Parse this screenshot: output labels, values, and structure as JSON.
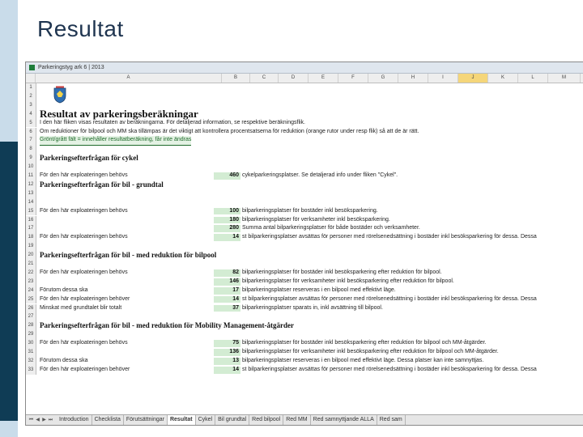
{
  "slide": {
    "title": "Resultat"
  },
  "window": {
    "title": "Parkeringstyg ark 6 | 2013"
  },
  "columns": [
    "A",
    "B",
    "C",
    "D",
    "E",
    "F",
    "G",
    "H",
    "I",
    "J",
    "K",
    "L",
    "M"
  ],
  "selected_column": "J",
  "rows": [
    {
      "n": "1"
    },
    {
      "n": "2"
    },
    {
      "n": "3"
    },
    {
      "n": "4",
      "a": "Resultat av parkeringsberäkningar"
    },
    {
      "n": "5",
      "a": "I den här fliken visas resultaten av beräkningarna. För detaljerad information, se respektive beräkningsflik."
    },
    {
      "n": "6",
      "a": "Om reduktioner för bilpool och MM ska tillämpas är det viktigt att kontrollera procentsatserna för reduktion (orange rutor under resp flik) så att de är rätt."
    },
    {
      "n": "7",
      "a": "Grönt/grått fält = innehåller resultatberäkning, får inte ändras"
    },
    {
      "n": "8"
    },
    {
      "n": "9",
      "a": "Parkeringsefterfrågan för cykel"
    },
    {
      "n": "10"
    },
    {
      "n": "11",
      "a": "För den här exploateringen behövs",
      "b": "460",
      "c": "cykelparkeringsplatser. Se detaljerad info under fliken \"Cykel\"."
    },
    {
      "n": "12",
      "a": "Parkeringsefterfrågan för bil - grundtal"
    },
    {
      "n": "13"
    },
    {
      "n": "14"
    },
    {
      "n": "15",
      "a": "För den här exploateringen behövs",
      "b": "100",
      "c": "bilparkeringsplatser för bostäder inkl besöksparkering."
    },
    {
      "n": "16",
      "b": "180",
      "c": "bilparkeringsplatser för verksamheter inkl besöksparkering."
    },
    {
      "n": "17",
      "b": "280",
      "c": "Summa antal bilparkeringsplatser för både bostäder och verksamheter."
    },
    {
      "n": "18",
      "a": "För den här exploateringen behövs",
      "b": "14",
      "c": "st bilparkeringsplatser avsättas för personer med rörelsenedsättning i bostäder inkl besöksparkering för dessa. Dessa"
    },
    {
      "n": "19"
    },
    {
      "n": "20",
      "a": "Parkeringsefterfrågan för bil - med reduktion för bilpool"
    },
    {
      "n": "21"
    },
    {
      "n": "22",
      "a": "För den här exploateringen behövs",
      "b": "82",
      "c": "bilparkeringsplatser för bostäder inkl besöksparkering efter reduktion för bilpool."
    },
    {
      "n": "23",
      "b": "146",
      "c": "bilparkeringsplatser för verksamheter inkl besöksparkering efter reduktion för bilpool."
    },
    {
      "n": "24",
      "a": "Förutom dessa ska",
      "b": "17",
      "c": "bilparkeringsplatser reserveras i en bilpool med effektivt läge."
    },
    {
      "n": "25",
      "a": "För den här exploateringen behöver",
      "b": "14",
      "c": "st bilparkeringsplatser avsättas för personer med rörelsenedsättning i bostäder inkl besöksparkering för dessa. Dessa"
    },
    {
      "n": "26",
      "a": "Minskat med grundtalet blir totalt",
      "b": "37",
      "c": "bilparkeringsplatser sparats in, inkl avsättning till bilpool."
    },
    {
      "n": "27"
    },
    {
      "n": "28",
      "a": "Parkeringsefterfrågan för bil - med reduktion för Mobility Management-åtgärder"
    },
    {
      "n": "29"
    },
    {
      "n": "30",
      "a": "För den här exploateringen behövs",
      "b": "75",
      "c": "bilparkeringsplatser för bostäder inkl besöksparkering efter reduktion för bilpool och MM-åtgärder."
    },
    {
      "n": "31",
      "b": "136",
      "c": "bilparkeringsplatser för verksamheter inkl besöksparkering efter reduktion för bilpool och MM-åtgärder."
    },
    {
      "n": "32",
      "a": "Förutom dessa ska",
      "b": "13",
      "c": "bilparkeringsplatser reserveras i en bilpool med effektivt läge. Dessa platser kan inte samnyttjas."
    },
    {
      "n": "33",
      "a": "För den här exploateringen behöver",
      "b": "14",
      "c": "st bilparkeringsplatser avsättas för personer med rörelsenedsättning i bostäder inkl besöksparkering för dessa. Dessa"
    }
  ],
  "tabs": [
    "Introduction",
    "Checklista",
    "Förutsättningar",
    "Resultat",
    "Cykel",
    "Bil grundtal",
    "Red bilpool",
    "Red MM",
    "Red samnyttjande ALLA",
    "Red sam"
  ],
  "active_tab": "Resultat",
  "colors": {
    "green_cell": "#d3ecd3",
    "header_bg": "#eeeeee",
    "selected_col": "#f5d67a",
    "sidebar_light": "#c9dcea",
    "sidebar_dark": "#0f3c55"
  }
}
